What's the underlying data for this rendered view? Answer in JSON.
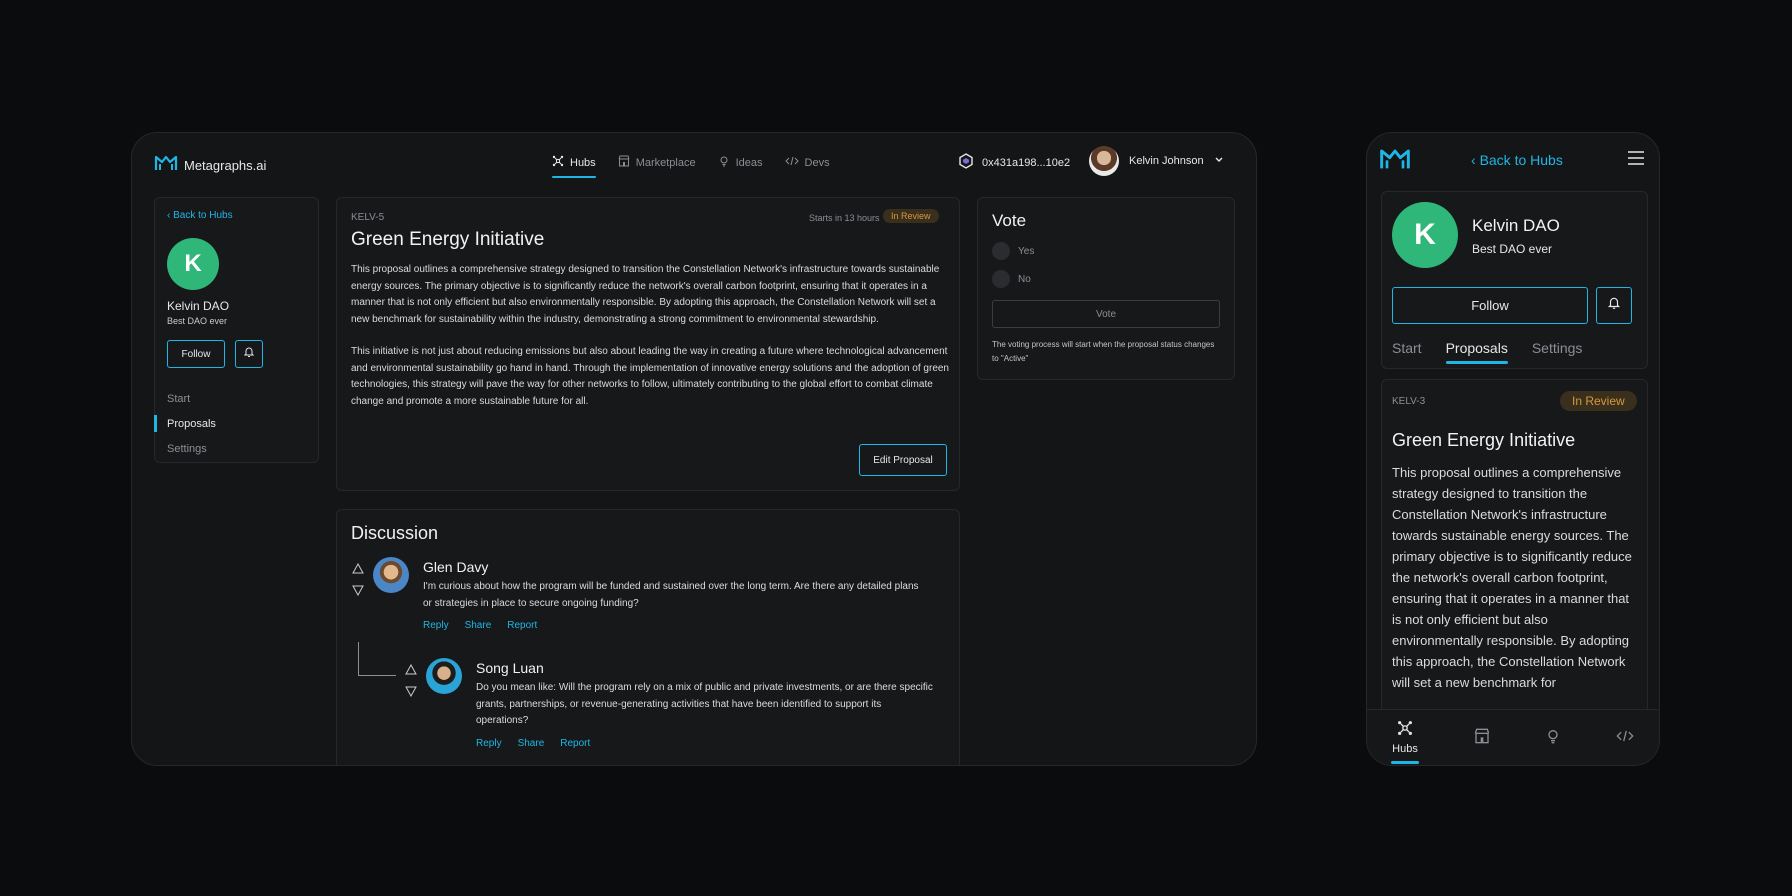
{
  "desktop": {
    "brand": "Metagraphs.ai",
    "nav": [
      {
        "label": "Hubs",
        "icon": "hubs-icon"
      },
      {
        "label": "Marketplace",
        "icon": "store-icon"
      },
      {
        "label": "Ideas",
        "icon": "bulb-icon"
      },
      {
        "label": "Devs",
        "icon": "code-icon"
      }
    ],
    "wallet": "0x431a198...10e2",
    "user": "Kelvin Johnson",
    "sidebar": {
      "back": "Back to Hubs",
      "avatar_letter": "K",
      "name": "Kelvin DAO",
      "tagline": "Best DAO ever",
      "follow": "Follow",
      "menu": [
        "Start",
        "Proposals",
        "Settings"
      ]
    },
    "proposal": {
      "id": "KELV-5",
      "time": "Starts in 13 hours",
      "status": "In Review",
      "title": "Green Energy Initiative",
      "para1": "This proposal outlines a comprehensive strategy designed to transition the Constellation Network's infrastructure towards sustainable energy sources. The primary objective is to significantly reduce the network's overall carbon footprint, ensuring that it operates in a manner that is not only efficient but also environmentally responsible. By adopting this approach, the Constellation Network will set a new benchmark for sustainability within the industry, demonstrating a strong commitment to environmental stewardship.",
      "para2": "This initiative is not just about reducing emissions but also about leading the way in creating a future where technological advancement and environmental sustainability go hand in hand. Through the implementation of innovative energy solutions and the adoption of green technologies, this strategy will pave the way for other networks to follow, ultimately contributing to the global effort to combat climate change and promote a more sustainable future for all.",
      "edit": "Edit Proposal"
    },
    "vote": {
      "title": "Vote",
      "options": [
        "Yes",
        "No"
      ],
      "button": "Vote",
      "note": "The voting process will start when the proposal status changes to \"Active\""
    },
    "discussion": {
      "title": "Discussion",
      "comments": [
        {
          "name": "Glen Davy",
          "text": "I'm curious about how the program will be funded and sustained over the long term. Are there any detailed plans or strategies in place to secure ongoing funding?",
          "actions": [
            "Reply",
            "Share",
            "Report"
          ]
        },
        {
          "name": "Song Luan",
          "text": "Do you mean like: Will the program rely on a mix of public and private investments, or are there specific grants, partnerships, or revenue-generating activities that have been identified to support its operations?",
          "actions": [
            "Reply",
            "Share",
            "Report"
          ]
        }
      ]
    }
  },
  "mobile": {
    "back": "Back to Hubs",
    "avatar_letter": "K",
    "name": "Kelvin DAO",
    "tagline": "Best DAO ever",
    "follow": "Follow",
    "tabs": [
      "Start",
      "Proposals",
      "Settings"
    ],
    "proposal": {
      "id": "KELV-3",
      "status": "In Review",
      "title": "Green Energy Initiative",
      "body": "This proposal outlines a comprehensive strategy designed to transition the Constellation Network's infrastructure towards sustainable energy sources. The primary objective is to significantly reduce the network's overall carbon footprint, ensuring that it operates in a manner that is not only efficient but also environmentally responsible. By adopting this approach, the Constellation Network will set a new benchmark for"
    },
    "bottom_nav": {
      "hubs": "Hubs"
    }
  },
  "colors": {
    "accent": "#1fb6e6",
    "dao_avatar": "#2fb679",
    "badge_text": "#d49a3f",
    "background": "#0b0c0d"
  }
}
